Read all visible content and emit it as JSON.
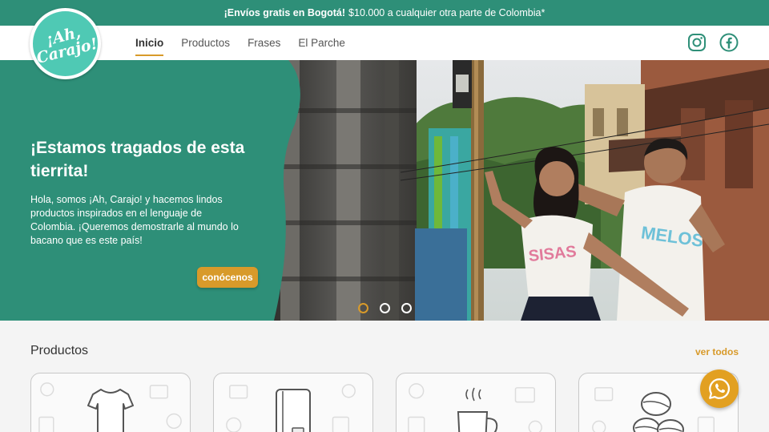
{
  "promo": {
    "bold": "¡Envíos gratis en Bogotá!",
    "text": "$10.000 a cualquier otra parte de Colombia*"
  },
  "logo": {
    "text": "¡Ah, Carajo!"
  },
  "nav": {
    "items": [
      {
        "label": "Inicio",
        "active": true
      },
      {
        "label": "Productos",
        "active": false
      },
      {
        "label": "Frases",
        "active": false
      },
      {
        "label": "El Parche",
        "active": false
      }
    ],
    "social": [
      "instagram-icon",
      "facebook-icon"
    ]
  },
  "hero": {
    "title": "¡Estamos tragados de esta tierrita!",
    "text": "Hola, somos ¡Ah, Carajo! y hacemos lindos productos inspirados en el lenguaje de Colombia. ¡Queremos demostrarle al mundo lo bacano que es este país!",
    "button": "conócenos",
    "shirt_text_1": "SISAS",
    "shirt_text_2": "MELOS",
    "slides": 3,
    "active_slide": 0
  },
  "products": {
    "title": "Productos",
    "see_all": "ver todos",
    "cards": [
      "t-shirt-icon",
      "notebook-icon",
      "mug-icon",
      "coffee-beans-icon"
    ]
  },
  "colors": {
    "brand_green": "#2e8f78",
    "logo_teal": "#4fc9b4",
    "accent_gold": "#d89a2a"
  }
}
